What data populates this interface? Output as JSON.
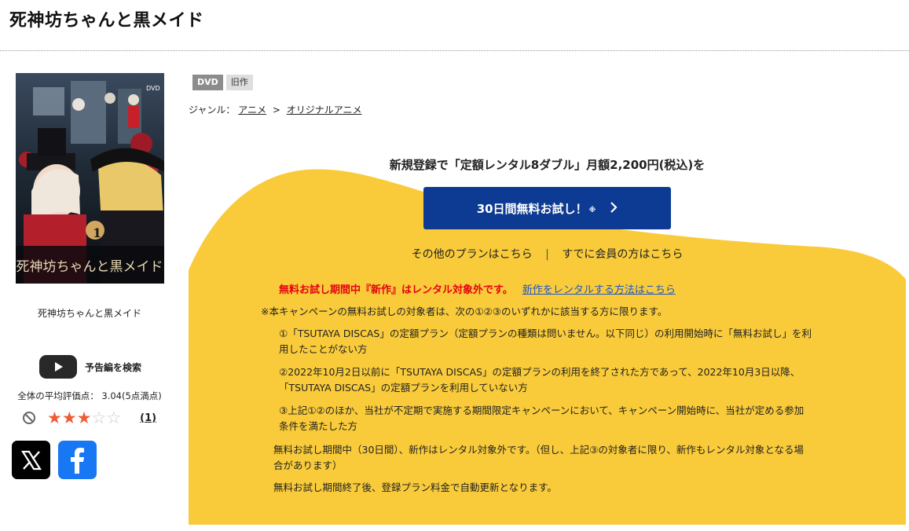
{
  "page": {
    "title": "死神坊ちゃんと黒メイド"
  },
  "poster": {
    "title_text": "死神坊ちゃんと黒メイド",
    "volume": "1"
  },
  "left": {
    "caption": "死神坊ちゃんと黒メイド",
    "trailer_label": "予告編を検索",
    "avg_rating": "全体の平均評価点： 3.04(5点満点)",
    "rating_stars": 3,
    "rating_count": "(1)"
  },
  "badges": {
    "dvd": "DVD",
    "old": "旧作"
  },
  "genre": {
    "label": "ジャンル：",
    "cat1": "アニメ",
    "sep": ">",
    "cat2": "オリジナルアニメ"
  },
  "promo": {
    "headline": "新規登録で「定額レンタル8ダブル」月額2,200円(税込)を",
    "cta_label": "30日間無料お試し！",
    "cta_note": "※",
    "other_plans": "その他のプランはこちら",
    "members": "すでに会員の方はこちら"
  },
  "notice": {
    "red": "無料お試し期間中『新作』はレンタル対象外です。",
    "link": "新作をレンタルする方法はこちら"
  },
  "terms": {
    "intro": "※本キャンペーンの無料お試しの対象者は、次の①②③のいずれかに該当する方に限ります。",
    "item1_line1": "①「TSUTAYA DISCAS」の定額プラン（定額プランの種類は問いません。以下同じ）の利用開始時に「無料お試し」を利",
    "item1_line2": "用したことがない方",
    "item2_line1": "②2022年10月2日以前に「TSUTAYA DISCAS」の定額プランの利用を終了された方であって、2022年10月3日以降、",
    "item2_line2": "「TSUTAYA DISCAS」の定額プランを利用していない方",
    "item3_line1": "③上記①②のほか、当社が不定期で実施する期間限定キャンペーンにおいて、キャンペーン開始時に、当社が定める参加",
    "item3_line2": "条件を満たした方",
    "note1_line1": "無料お試し期間中（30日間）、新作はレンタル対象外です。（但し、上記③の対象者に限り、新作もレンタル対象となる場",
    "note1_line2": "合があります）",
    "note2": "無料お試し期間終了後、登録プラン料金で自動更新となります。"
  },
  "colors": {
    "yellow": "#f9cb3a",
    "cta": "#0d3a92",
    "red": "#e60012",
    "star": "#ef5b35"
  }
}
